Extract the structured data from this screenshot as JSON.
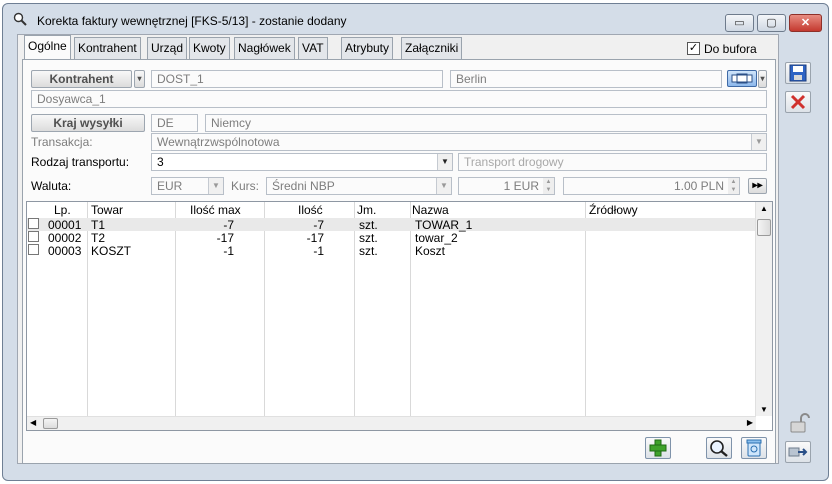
{
  "window": {
    "title": "Korekta faktury wewnętrznej [FKS-5/13]  - zostanie dodany",
    "minimize": "▭",
    "maximize": "▢",
    "close": "✕"
  },
  "tabs": [
    {
      "label": "Ogólne"
    },
    {
      "label": "Kontrahent"
    },
    {
      "label": "Urząd"
    },
    {
      "label": "Kwoty"
    },
    {
      "label": "Nagłówek"
    },
    {
      "label": "VAT"
    },
    {
      "label": "Atrybuty"
    },
    {
      "label": "Załączniki"
    }
  ],
  "do_bufora": {
    "label": "Do bufora",
    "checked": true,
    "mark": "✓"
  },
  "kontrahent": {
    "button_label": "Kontrahent",
    "code": "DOST_1",
    "city": "Berlin",
    "name": "Dosyawca_1"
  },
  "kraj_wysylki": {
    "button_label": "Kraj wysyłki",
    "code": "DE",
    "name": "Niemcy"
  },
  "transakcja": {
    "label": "Transakcja:",
    "value": "Wewnątrzwspólnotowa"
  },
  "rodzaj_transportu": {
    "label": "Rodzaj transportu:",
    "value": "3",
    "description": "Transport drogowy"
  },
  "waluta": {
    "label": "Waluta:",
    "currency": "EUR",
    "kurs_label": "Kurs:",
    "kurs_type": "Średni NBP",
    "amount_foreign": "1 EUR",
    "amount_pln": "1.00 PLN",
    "next_symbol": "▸▸"
  },
  "table": {
    "columns": [
      "Lp.",
      "Towar",
      "Ilość max",
      "Ilość",
      "Jm.",
      "Nazwa",
      "Źródłowy"
    ],
    "rows": [
      {
        "lp": "00001",
        "towar": "T1",
        "ilosc_max": "-7",
        "ilosc": "-7",
        "jm": "szt.",
        "nazwa": "TOWAR_1",
        "zrodlowy": ""
      },
      {
        "lp": "00002",
        "towar": "T2",
        "ilosc_max": "-17",
        "ilosc": "-17",
        "jm": "szt.",
        "nazwa": "towar_2",
        "zrodlowy": ""
      },
      {
        "lp": "00003",
        "towar": "KOSZT",
        "ilosc_max": "-1",
        "ilosc": "-1",
        "jm": "szt.",
        "nazwa": "Koszt",
        "zrodlowy": ""
      }
    ]
  },
  "colors": {
    "title_bg": "#d4dde8",
    "close_red": "#c9463d",
    "add_green": "#3fa22b",
    "selected_row": "#e9e9e9"
  }
}
